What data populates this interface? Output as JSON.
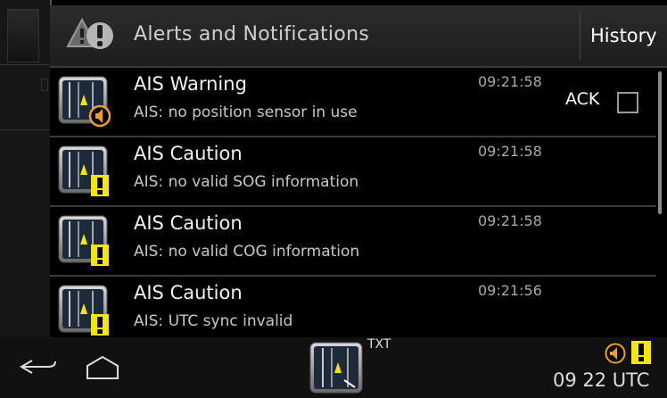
{
  "header": {
    "title": "Alerts and Notifications",
    "history_label": "History"
  },
  "alerts": [
    {
      "name": "AIS Warning",
      "description": "AIS: no position sensor in use",
      "time": "09:21:58",
      "level": "warning",
      "icon": "radar-speaker-icon"
    },
    {
      "name": "AIS Caution",
      "description": "AIS: no valid SOG information",
      "time": "09:21:58",
      "level": "caution",
      "icon": "radar-exclamation-icon"
    },
    {
      "name": "AIS Caution",
      "description": "AIS: no valid COG information",
      "time": "09:21:58",
      "level": "caution",
      "icon": "radar-exclamation-icon"
    },
    {
      "name": "AIS Caution",
      "description": "AIS: UTC sync invalid",
      "time": "09:21:56",
      "level": "caution",
      "icon": "radar-exclamation-icon"
    }
  ],
  "ack": {
    "label": "ACK",
    "checked": false
  },
  "navbar": {
    "txt_label": "TXT",
    "clock": "09 22 UTC"
  },
  "colors": {
    "warning_orange": "#f0a020",
    "caution_yellow": "#f7e600",
    "background": "#000000"
  }
}
